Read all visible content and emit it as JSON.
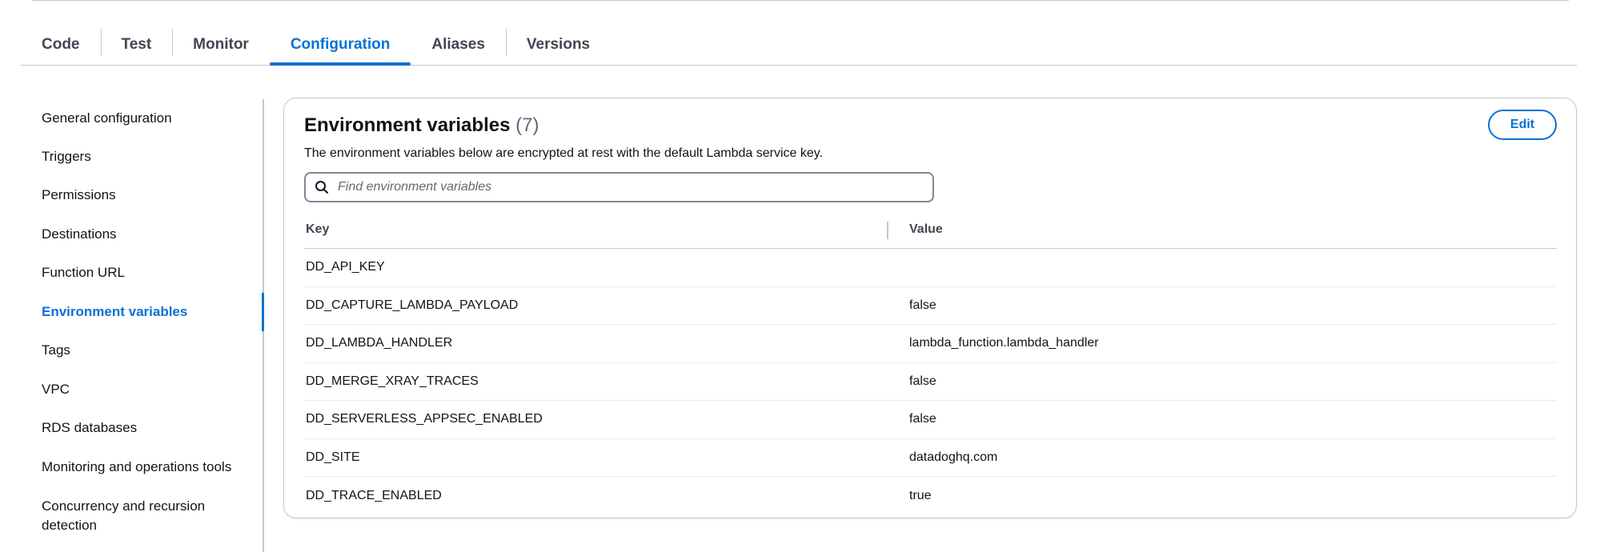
{
  "tabs": [
    {
      "label": "Code",
      "active": false
    },
    {
      "label": "Test",
      "active": false
    },
    {
      "label": "Monitor",
      "active": false
    },
    {
      "label": "Configuration",
      "active": true
    },
    {
      "label": "Aliases",
      "active": false
    },
    {
      "label": "Versions",
      "active": false
    }
  ],
  "sidebar": {
    "items": [
      {
        "label": "General configuration"
      },
      {
        "label": "Triggers"
      },
      {
        "label": "Permissions"
      },
      {
        "label": "Destinations"
      },
      {
        "label": "Function URL"
      },
      {
        "label": "Environment variables",
        "active": true
      },
      {
        "label": "Tags"
      },
      {
        "label": "VPC"
      },
      {
        "label": "RDS databases"
      },
      {
        "label": "Monitoring and operations tools"
      },
      {
        "label": "Concurrency and recursion detection"
      }
    ]
  },
  "panel": {
    "title": "Environment variables",
    "count": "(7)",
    "description": "The environment variables below are encrypted at rest with the default Lambda service key.",
    "edit_label": "Edit",
    "search_placeholder": "Find environment variables",
    "columns": {
      "key": "Key",
      "value": "Value"
    },
    "rows": [
      {
        "key": "DD_API_KEY",
        "value": ""
      },
      {
        "key": "DD_CAPTURE_LAMBDA_PAYLOAD",
        "value": "false"
      },
      {
        "key": "DD_LAMBDA_HANDLER",
        "value": "lambda_function.lambda_handler"
      },
      {
        "key": "DD_MERGE_XRAY_TRACES",
        "value": "false"
      },
      {
        "key": "DD_SERVERLESS_APPSEC_ENABLED",
        "value": "false"
      },
      {
        "key": "DD_SITE",
        "value": "datadoghq.com"
      },
      {
        "key": "DD_TRACE_ENABLED",
        "value": "true"
      }
    ]
  },
  "colors": {
    "accent": "#0972d3",
    "text": "#0f141a",
    "border": "#c6c6cd"
  },
  "icons": {
    "search": "search-icon"
  }
}
